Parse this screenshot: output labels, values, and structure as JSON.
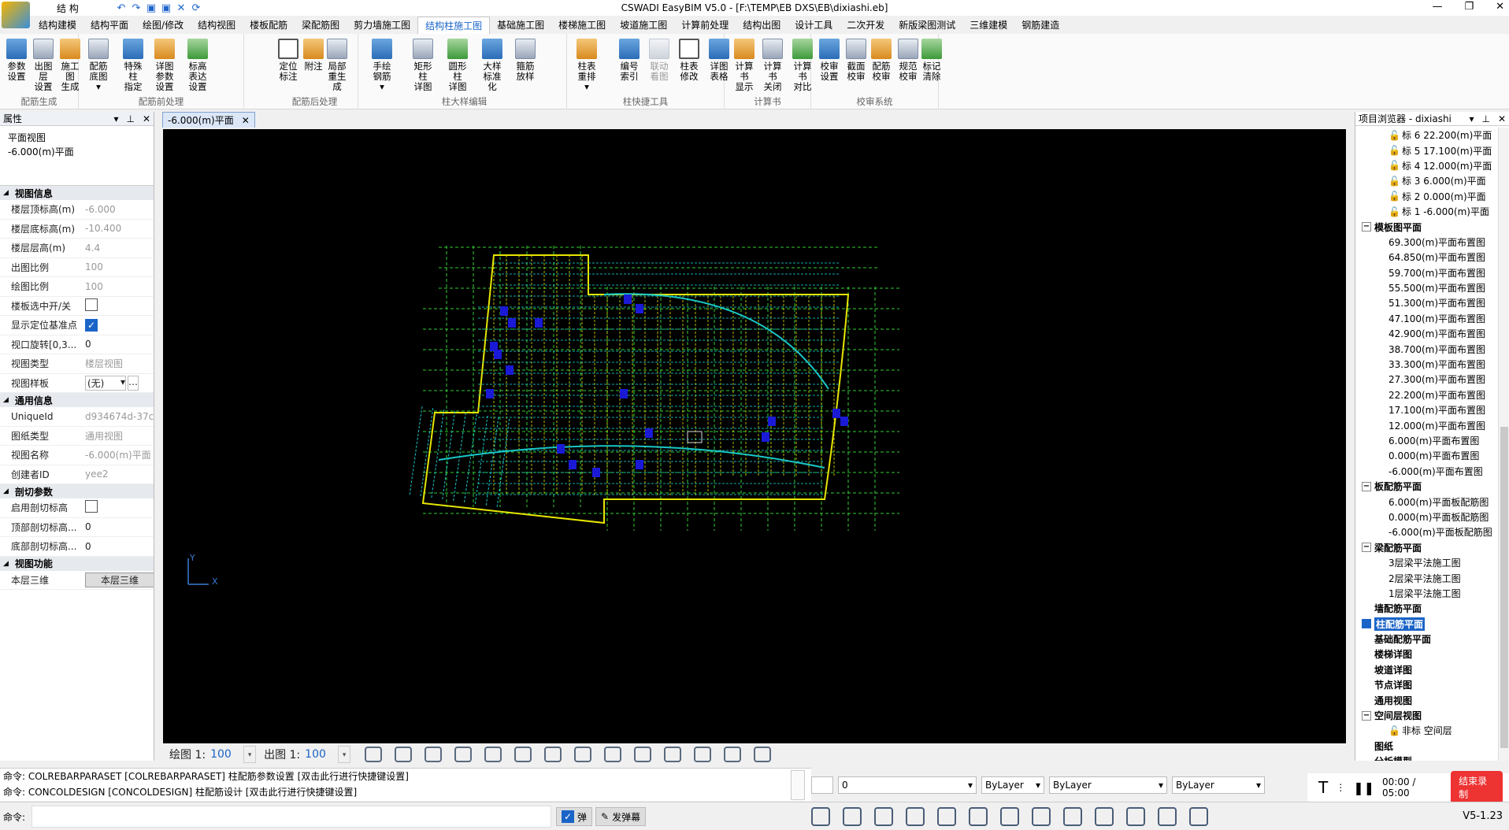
{
  "app": {
    "window_title": "CSWADI EasyBIM V5.0 - [F:\\TEMP\\EB DXS\\EB\\dixiashi.eb]",
    "workspace": "结 构"
  },
  "menu_tabs": [
    "结构建模",
    "结构平面",
    "绘图/修改",
    "结构视图",
    "楼板配筋",
    "梁配筋图",
    "剪力墙施工图",
    "结构柱施工图",
    "基础施工图",
    "楼梯施工图",
    "坡道施工图",
    "计算前处理",
    "结构出图",
    "设计工具",
    "二次开发",
    "新版梁图测试",
    "三维建模",
    "钢筋建造"
  ],
  "active_tab_index": 7,
  "ribbon": {
    "groups": [
      {
        "label": "配筋生成",
        "buttons": [
          {
            "l1": "参数",
            "l2": "设置"
          },
          {
            "l1": "出图层",
            "l2": "设置"
          },
          {
            "l1": "施工图",
            "l2": "生成"
          }
        ]
      },
      {
        "label": "配筋前处理",
        "buttons": [
          {
            "l1": "配筋底图",
            "l2": "▾"
          },
          {
            "l1": "特殊柱",
            "l2": "指定"
          },
          {
            "l1": "详图参数",
            "l2": "设置"
          },
          {
            "l1": "标高表达",
            "l2": "设置"
          }
        ]
      },
      {
        "label": "配筋后处理",
        "buttons": [
          {
            "l1": "定位",
            "l2": "标注"
          },
          {
            "l1": "附注",
            "l2": ""
          },
          {
            "l1": "局部",
            "l2": "重生成"
          }
        ]
      },
      {
        "label": "柱大样编辑",
        "buttons": [
          {
            "l1": "手绘钢筋",
            "l2": "▾"
          },
          {
            "l1": "矩形柱",
            "l2": "详图"
          },
          {
            "l1": "圆形柱",
            "l2": "详图"
          },
          {
            "l1": "大样",
            "l2": "标准化"
          },
          {
            "l1": "箍筋",
            "l2": "放样"
          }
        ]
      },
      {
        "label": "柱快捷工具",
        "buttons": [
          {
            "l1": "柱表重排",
            "l2": "▾"
          },
          {
            "l1": "编号",
            "l2": "索引"
          },
          {
            "l1": "联动",
            "l2": "看图"
          },
          {
            "l1": "柱表",
            "l2": "修改"
          },
          {
            "l1": "详图",
            "l2": "表格"
          }
        ]
      },
      {
        "label": "计算书",
        "buttons": [
          {
            "l1": "计算书",
            "l2": "显示"
          },
          {
            "l1": "计算书",
            "l2": "关闭"
          },
          {
            "l1": "计算书",
            "l2": "对比"
          }
        ]
      },
      {
        "label": "校审系统",
        "buttons": [
          {
            "l1": "校审",
            "l2": "设置"
          },
          {
            "l1": "截面",
            "l2": "校审"
          },
          {
            "l1": "配筋",
            "l2": "校审"
          },
          {
            "l1": "规范",
            "l2": "校审"
          },
          {
            "l1": "标记",
            "l2": "清除"
          }
        ]
      }
    ]
  },
  "properties": {
    "title": "属性",
    "view_type_line1": "平面视图",
    "view_type_line2": "-6.000(m)平面",
    "sections": [
      {
        "name": "视图信息",
        "rows": [
          {
            "k": "楼层顶标高(m)",
            "v": "-6.000"
          },
          {
            "k": "楼层底标高(m)",
            "v": "-10.400"
          },
          {
            "k": "楼层层高(m)",
            "v": "4.4"
          },
          {
            "k": "出图比例",
            "v": "100"
          },
          {
            "k": "绘图比例",
            "v": "100"
          },
          {
            "k": "楼板选中开/关",
            "v": "",
            "check": false
          },
          {
            "k": "显示定位基准点",
            "v": "",
            "check": true
          },
          {
            "k": "视口旋转[0,3...",
            "v": "0",
            "dark": true
          },
          {
            "k": "视图类型",
            "v": "楼层视图"
          },
          {
            "k": "视图样板",
            "v": "(无)",
            "combo": true
          }
        ]
      },
      {
        "name": "通用信息",
        "rows": [
          {
            "k": "UniqueId",
            "v": "d934674d-37c"
          },
          {
            "k": "图纸类型",
            "v": "通用视图"
          },
          {
            "k": "视图名称",
            "v": "-6.000(m)平面"
          },
          {
            "k": "创建者ID",
            "v": "yee2"
          }
        ]
      },
      {
        "name": "剖切参数",
        "rows": [
          {
            "k": "启用剖切标高",
            "v": "",
            "check": false
          },
          {
            "k": "顶部剖切标高...",
            "v": "0",
            "dark": true
          },
          {
            "k": "底部剖切标高...",
            "v": "0",
            "dark": true
          }
        ]
      },
      {
        "name": "视图功能",
        "rows": [
          {
            "k": "本层三维",
            "v": "本层三维",
            "button": true
          }
        ]
      }
    ]
  },
  "document_tab": "-6.000(m)平面",
  "canvas": {
    "axis_x": "X",
    "axis_y": "Y"
  },
  "canvas_bar": {
    "draw_label": "绘图 1:",
    "draw_scale": "100",
    "print_label": "出图 1:",
    "print_scale": "100"
  },
  "browser": {
    "title": "项目浏览器 - dixiashi",
    "nodes": [
      {
        "t": "标 6 22.200(m)平面",
        "lvl": 2,
        "lock": true
      },
      {
        "t": "标 5 17.100(m)平面",
        "lvl": 2,
        "lock": true
      },
      {
        "t": "标 4 12.000(m)平面",
        "lvl": 2,
        "lock": true
      },
      {
        "t": "标 3 6.000(m)平面",
        "lvl": 2,
        "lock": true
      },
      {
        "t": "标 2 0.000(m)平面",
        "lvl": 2,
        "lock": true
      },
      {
        "t": "标 1 -6.000(m)平面",
        "lvl": 2,
        "lock": true
      },
      {
        "t": "模板图平面",
        "lvl": 1,
        "exp": "−"
      },
      {
        "t": "69.300(m)平面布置图",
        "lvl": 2
      },
      {
        "t": "64.850(m)平面布置图",
        "lvl": 2
      },
      {
        "t": "59.700(m)平面布置图",
        "lvl": 2
      },
      {
        "t": "55.500(m)平面布置图",
        "lvl": 2
      },
      {
        "t": "51.300(m)平面布置图",
        "lvl": 2
      },
      {
        "t": "47.100(m)平面布置图",
        "lvl": 2
      },
      {
        "t": "42.900(m)平面布置图",
        "lvl": 2
      },
      {
        "t": "38.700(m)平面布置图",
        "lvl": 2
      },
      {
        "t": "33.300(m)平面布置图",
        "lvl": 2
      },
      {
        "t": "27.300(m)平面布置图",
        "lvl": 2
      },
      {
        "t": "22.200(m)平面布置图",
        "lvl": 2
      },
      {
        "t": "17.100(m)平面布置图",
        "lvl": 2
      },
      {
        "t": "12.000(m)平面布置图",
        "lvl": 2
      },
      {
        "t": "6.000(m)平面布置图",
        "lvl": 2
      },
      {
        "t": "0.000(m)平面布置图",
        "lvl": 2
      },
      {
        "t": "-6.000(m)平面布置图",
        "lvl": 2
      },
      {
        "t": "板配筋平面",
        "lvl": 1,
        "exp": "−"
      },
      {
        "t": "6.000(m)平面板配筋图",
        "lvl": 2
      },
      {
        "t": "0.000(m)平面板配筋图",
        "lvl": 2
      },
      {
        "t": "-6.000(m)平面板配筋图",
        "lvl": 2
      },
      {
        "t": "梁配筋平面",
        "lvl": 1,
        "exp": "−"
      },
      {
        "t": "3层梁平法施工图",
        "lvl": 2
      },
      {
        "t": "2层梁平法施工图",
        "lvl": 2
      },
      {
        "t": "1层梁平法施工图",
        "lvl": 2
      },
      {
        "t": "墙配筋平面",
        "lvl": 1
      },
      {
        "t": "柱配筋平面",
        "lvl": 1,
        "sel": true
      },
      {
        "t": "基础配筋平面",
        "lvl": 1
      },
      {
        "t": "楼梯详图",
        "lvl": 1
      },
      {
        "t": "坡道详图",
        "lvl": 1
      },
      {
        "t": "节点详图",
        "lvl": 1
      },
      {
        "t": "通用视图",
        "lvl": 1
      },
      {
        "t": "空间层视图",
        "lvl": 1,
        "exp": "−"
      },
      {
        "t": "非标 空间层",
        "lvl": 2,
        "lock": true
      },
      {
        "t": "图纸",
        "lvl": 1
      },
      {
        "t": "分析模型",
        "lvl": 1
      }
    ]
  },
  "command": {
    "line1": "命令: COLREBARPARASET [COLREBARPARASET] 柱配筋参数设置 [双击此行进行快捷键设置]",
    "line2": "命令: CONCOLDESIGN [CONCOLDESIGN] 柱配筋设计 [双击此行进行快捷键设置]",
    "prompt": "命令:"
  },
  "layer_bar": {
    "layer": "0",
    "color": "ByLayer",
    "linetype": "ByLayer",
    "lineweight": "ByLayer"
  },
  "recorder": {
    "time": "00:00 / 05:00",
    "stop": "结束录制"
  },
  "status": {
    "toggle1": "弹",
    "toggle2": "发弹幕",
    "version": "V5-1.23"
  }
}
